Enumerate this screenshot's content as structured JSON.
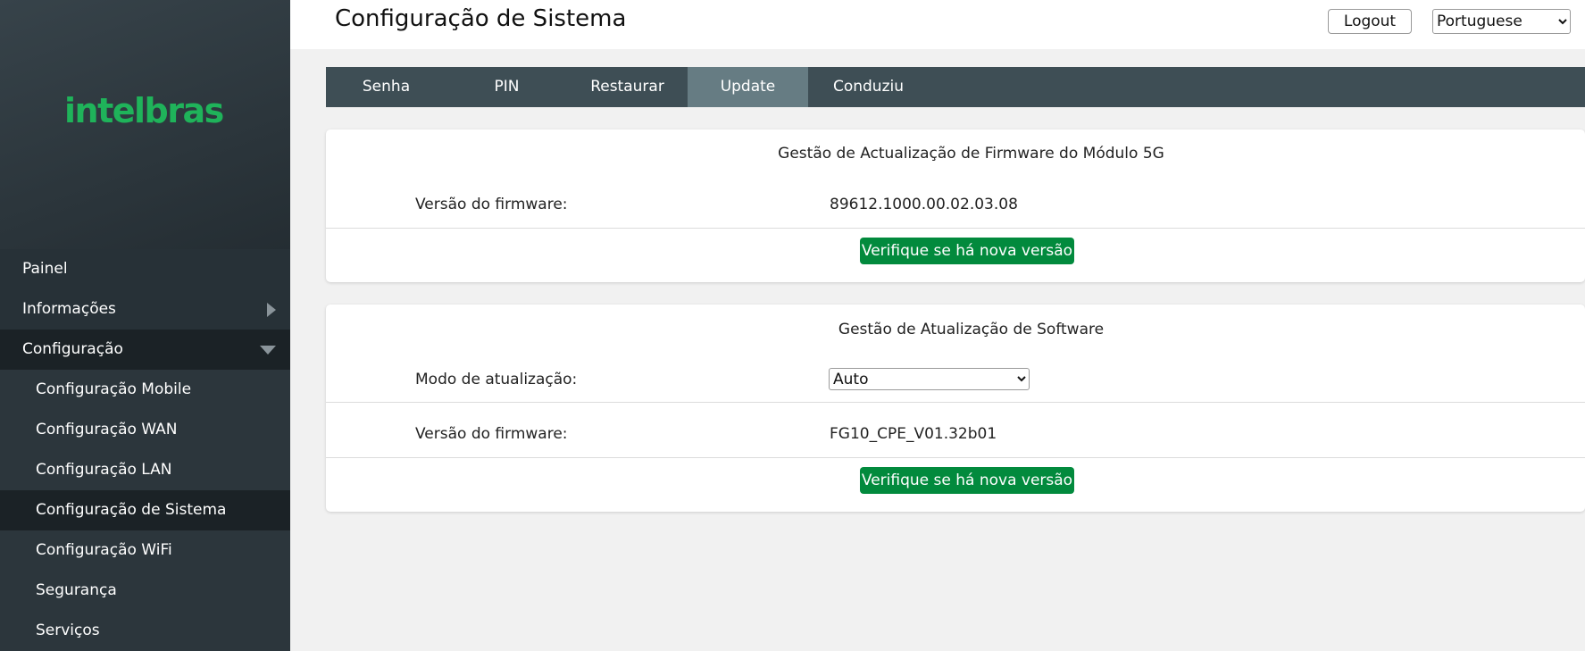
{
  "brand": {
    "logo_text": "intelbras",
    "logo_color": "#1fb35a"
  },
  "header": {
    "title": "Configuração de Sistema",
    "logout_label": "Logout",
    "language_selected": "Portuguese"
  },
  "sidebar": {
    "items": [
      {
        "label": "Painel"
      },
      {
        "label": "Informações",
        "icon": "chevron-right-icon"
      },
      {
        "label": "Configuração",
        "icon": "chevron-down-icon",
        "expanded": true
      }
    ],
    "subitems": [
      {
        "label": "Configuração Mobile"
      },
      {
        "label": "Configuração WAN"
      },
      {
        "label": "Configuração LAN"
      },
      {
        "label": "Configuração de Sistema",
        "active": true
      },
      {
        "label": "Configuração WiFi"
      },
      {
        "label": "Segurança"
      },
      {
        "label": "Serviços"
      }
    ]
  },
  "tabs": [
    {
      "label": "Senha"
    },
    {
      "label": "PIN"
    },
    {
      "label": "Restaurar"
    },
    {
      "label": "Update",
      "active": true
    },
    {
      "label": "Conduziu"
    }
  ],
  "module_update": {
    "title": "Gestão de Actualização de Firmware do Módulo 5G",
    "firmware_label": "Versão do firmware:",
    "firmware_value": "89612.1000.00.02.03.08",
    "check_button": "Verifique se há nova versão"
  },
  "software_update": {
    "title": "Gestão de Atualização de Software",
    "mode_label": "Modo de atualização:",
    "mode_selected": "Auto",
    "firmware_label": "Versão do firmware:",
    "firmware_value": "FG10_CPE_V01.32b01",
    "check_button": "Verifique se há nova versão"
  },
  "colors": {
    "accent_green": "#028a3d",
    "tabbar": "#3e4e55",
    "tab_active": "#667c83",
    "sidebar_dark": "#1b2226"
  }
}
